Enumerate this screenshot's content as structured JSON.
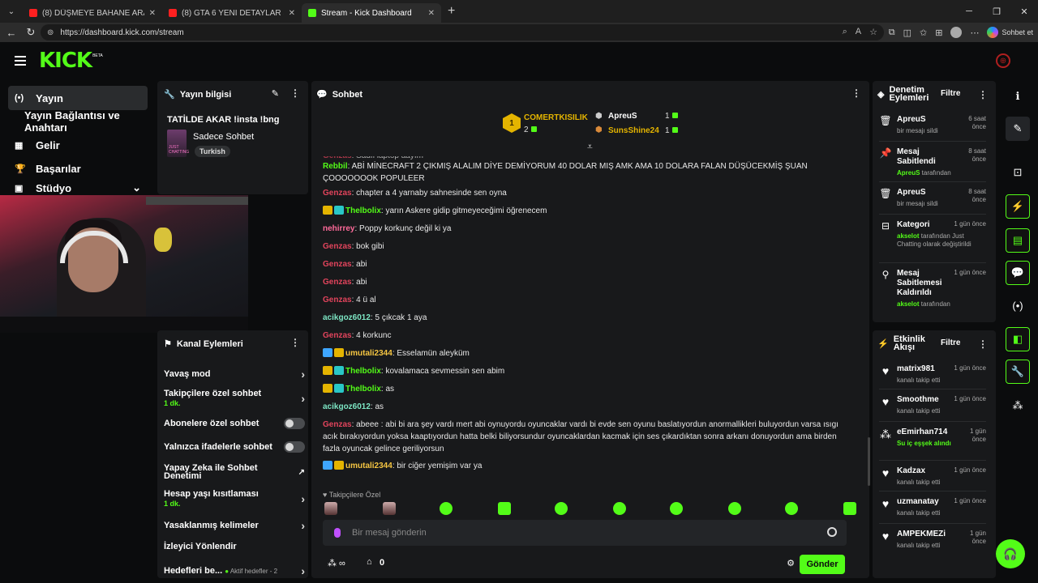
{
  "browser": {
    "tabs": [
      {
        "title": "(8) DÜŞMEYE BAHANE ARAMAK | ",
        "color": "#ff2020"
      },
      {
        "title": "(8) GTA 6 YENİ DETAYLAR SIZDI! Y",
        "color": "#ff2020"
      },
      {
        "title": "Stream - Kick Dashboard",
        "color": "#53fc18"
      }
    ],
    "url": "https://dashboard.kick.com/stream",
    "copilot_label": "Sohbet et"
  },
  "app": {
    "logo": "KICK",
    "beta": "BETA"
  },
  "left_nav": {
    "items": [
      {
        "label": "Yayın",
        "icon": "broadcast-icon"
      },
      {
        "label": "Yayın Bağlantısı ve Anahtarı",
        "icon": ""
      },
      {
        "label": "Gelir",
        "icon": "chart-icon"
      },
      {
        "label": "Başarılar",
        "icon": "trophy-icon"
      },
      {
        "label": "Stüdyo",
        "icon": "studio-icon"
      }
    ]
  },
  "stream_info": {
    "title": "Yayın bilgisi",
    "stream_title": "TATİLDE AKAR !insta !bng",
    "category": "Sadece Sohbet",
    "language": "Turkish",
    "thumb_text": "JUST CHATTING"
  },
  "channel_actions": {
    "title": "Kanal Eylemleri",
    "items": [
      {
        "label": "Yavaş mod",
        "sub": "",
        "ctl": "chevron"
      },
      {
        "label": "Takipçilere özel sohbet",
        "sub": "1 dk.",
        "ctl": "chevron"
      },
      {
        "label": "Abonelere özel sohbet",
        "sub": "",
        "ctl": "toggle"
      },
      {
        "label": "Yalnızca ifadelerle sohbet",
        "sub": "",
        "ctl": "toggle"
      },
      {
        "label": "Yapay Zeka ile Sohbet Denetimi",
        "sub": "",
        "ctl": "external"
      },
      {
        "label": "Hesap yaşı kısıtlaması",
        "sub": "1 dk.",
        "ctl": "chevron"
      },
      {
        "label": "Yasaklanmış kelimeler",
        "sub": "",
        "ctl": "chevron"
      },
      {
        "label": "İzleyici Yönlendir",
        "sub": "",
        "ctl": ""
      },
      {
        "label": "Hedefleri be...",
        "sub": "Aktif hedefler - 2",
        "ctl": "chevron"
      }
    ]
  },
  "chat": {
    "title": "Sohbet",
    "leaderboard": {
      "first_name": "COMERTKISILIK",
      "first_count": "2",
      "second_name": "ApreuS",
      "second_count": "1",
      "third_name": "SunsShine24",
      "third_count": "1",
      "rank": "1"
    },
    "messages": [
      {
        "user": "Genzas",
        "color": "#e2445c",
        "text": "Sadfl laptop aayım",
        "badges": []
      },
      {
        "user": "Rebbil",
        "color": "#53fc18",
        "text": "ABİ MİNECRAFT 2 ÇIKMIŞ ALALIM DİYE DEMİYORUM 40 DOLAR MIŞ AMK AMA 10 DOLARA FALAN DÜŞÜCEKMİŞ ŞUAN ÇOOOOOOOK POPULEER",
        "badges": []
      },
      {
        "user": "Genzas",
        "color": "#e2445c",
        "text": "chapter a 4 yarnaby sahnesinde sen oyna",
        "badges": []
      },
      {
        "user": "Thelbolix",
        "color": "#53fc18",
        "text": "yarın Askere gidip gitmeyeceğimi öğrenecem",
        "badges": [
          "crown",
          "sub"
        ]
      },
      {
        "user": "nehirrey",
        "color": "#ff6a9a",
        "text": "Poppy korkunç değil ki ya",
        "badges": []
      },
      {
        "user": "Genzas",
        "color": "#e2445c",
        "text": "bok gibi",
        "badges": []
      },
      {
        "user": "Genzas",
        "color": "#e2445c",
        "text": "abi",
        "badges": []
      },
      {
        "user": "Genzas",
        "color": "#e2445c",
        "text": "abi",
        "badges": []
      },
      {
        "user": "Genzas",
        "color": "#e2445c",
        "text": "4 ü al",
        "badges": []
      },
      {
        "user": "acikgoz6012",
        "color": "#7de6c4",
        "text": "5 çıkcak 1 aya",
        "badges": []
      },
      {
        "user": "Genzas",
        "color": "#e2445c",
        "text": "4 korkunc",
        "badges": []
      },
      {
        "user": "umutali2344",
        "color": "#f5c542",
        "text": "Esselamün aleyküm",
        "badges": [
          "mod",
          "crown"
        ]
      },
      {
        "user": "Thelbolix",
        "color": "#53fc18",
        "text": "kovalamaca sevmessin sen abim",
        "badges": [
          "crown",
          "sub"
        ]
      },
      {
        "user": "Thelbolix",
        "color": "#53fc18",
        "text": "as",
        "badges": [
          "crown",
          "sub"
        ]
      },
      {
        "user": "acikgoz6012",
        "color": "#7de6c4",
        "text": "as",
        "badges": []
      },
      {
        "user": "Genzas",
        "color": "#e2445c",
        "text": "abeee : abi bi ara şey vardı mert abi oynuyordu oyuncaklar vardı bi evde sen oyunu baslatıyordun anormallikleri buluyordun varsa ısıgı acık bırakıyordun yoksa kaaptıyordun hatta belki biliyorsundur oyuncaklardan kacmak için ses çıkardıktan sonra arkanı donuyordun ama birden fazla oyuncak gelince geriliyorsun",
        "badges": []
      },
      {
        "user": "umutali2344",
        "color": "#f5c542",
        "text": "bir ciğer yemişim var ya",
        "badges": [
          "mod",
          "crown"
        ]
      }
    ],
    "followers_only": "Takipçilere Özel",
    "input_placeholder": "Bir mesaj gönderin",
    "points": "0",
    "send_label": "Gönder"
  },
  "mod_actions": {
    "title": "Denetim Eylemleri",
    "filter": "Filtre",
    "items": [
      {
        "icon": "trash-icon",
        "title": "ApreuS",
        "time": "6 saat önce",
        "sub_green": "",
        "sub": "bir mesajı sildi"
      },
      {
        "icon": "pin-icon",
        "title": "Mesaj Sabitlendi",
        "time": "8 saat önce",
        "sub_green": "ApreuS",
        "sub": " tarafından"
      },
      {
        "icon": "trash-icon",
        "title": "ApreuS",
        "time": "8 saat önce",
        "sub_green": "",
        "sub": "bir mesajı sildi"
      },
      {
        "icon": "category-icon",
        "title": "Kategori",
        "time": "1 gün önce",
        "sub_green": "akselot",
        "sub": " tarafından Just Chatting olarak değiştirildi"
      },
      {
        "icon": "unpin-icon",
        "title": "Mesaj Sabitlemesi Kaldırıldı",
        "time": "1 gün önce",
        "sub_green": "akselot",
        "sub": " tarafından"
      }
    ]
  },
  "activity": {
    "title": "Etkinlik Akışı",
    "filter": "Filtre",
    "items": [
      {
        "icon": "heart-icon",
        "title": "matrix981",
        "time": "1 gün önce",
        "sub": "kanalı takip etti"
      },
      {
        "icon": "heart-icon",
        "title": "Smoothme",
        "time": "1 gün önce",
        "sub": "kanalı takip etti"
      },
      {
        "icon": "drops-icon",
        "title": "eEmirhan714",
        "time": "1 gün önce",
        "sub": "Su iç eşşek alındı"
      },
      {
        "icon": "heart-icon",
        "title": "Kadzax",
        "time": "1 gün önce",
        "sub": "kanalı takip etti"
      },
      {
        "icon": "heart-icon",
        "title": "uzmanatay",
        "time": "1 gün önce",
        "sub": "kanalı takip etti"
      },
      {
        "icon": "heart-icon",
        "title": "AMPEKMEZi",
        "time": "1 gün önce",
        "sub": "kanalı takip etti"
      }
    ]
  }
}
